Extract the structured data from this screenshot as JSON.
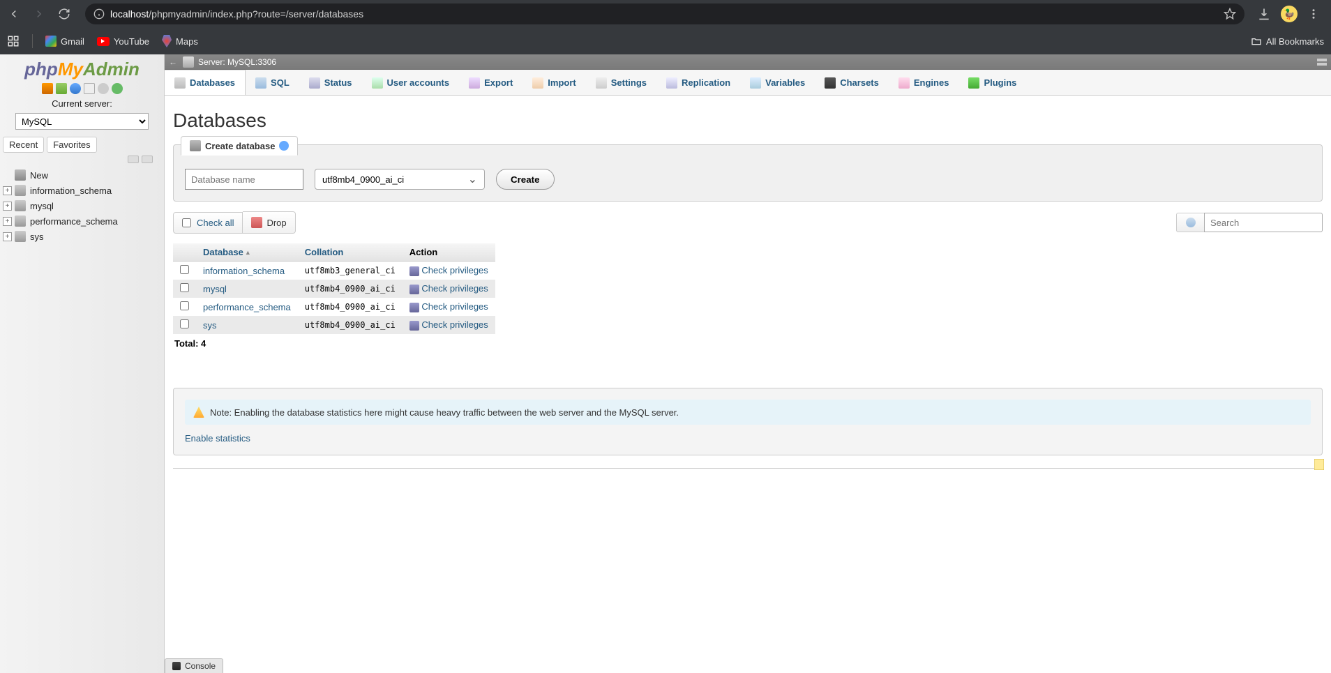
{
  "browser": {
    "url_host": "localhost",
    "url_path": "/phpmyadmin/index.php?route=/server/databases",
    "bookmarks": {
      "gmail": "Gmail",
      "youtube": "YouTube",
      "maps": "Maps",
      "all": "All Bookmarks"
    }
  },
  "sidebar": {
    "current_server_label": "Current server:",
    "server_value": "MySQL",
    "tabs": {
      "recent": "Recent",
      "favorites": "Favorites"
    },
    "new_label": "New",
    "nodes": [
      "information_schema",
      "mysql",
      "performance_schema",
      "sys"
    ]
  },
  "breadcrumb": {
    "server_label": "Server:",
    "server_value": "MySQL:3306"
  },
  "topmenu": {
    "databases": "Databases",
    "sql": "SQL",
    "status": "Status",
    "users": "User accounts",
    "export": "Export",
    "import": "Import",
    "settings": "Settings",
    "replication": "Replication",
    "variables": "Variables",
    "charsets": "Charsets",
    "engines": "Engines",
    "plugins": "Plugins"
  },
  "page": {
    "title": "Databases",
    "create_legend": "Create database",
    "dbname_placeholder": "Database name",
    "collation_value": "utf8mb4_0900_ai_ci",
    "create_btn": "Create",
    "check_all": "Check all",
    "drop": "Drop",
    "search_placeholder": "Search",
    "headers": {
      "database": "Database",
      "collation": "Collation",
      "action": "Action"
    },
    "rows": [
      {
        "name": "information_schema",
        "collation": "utf8mb3_general_ci",
        "action": "Check privileges"
      },
      {
        "name": "mysql",
        "collation": "utf8mb4_0900_ai_ci",
        "action": "Check privileges"
      },
      {
        "name": "performance_schema",
        "collation": "utf8mb4_0900_ai_ci",
        "action": "Check privileges"
      },
      {
        "name": "sys",
        "collation": "utf8mb4_0900_ai_ci",
        "action": "Check privileges"
      }
    ],
    "total_label": "Total: 4",
    "notice": "Note: Enabling the database statistics here might cause heavy traffic between the web server and the MySQL server.",
    "enable_stats": "Enable statistics"
  },
  "console_label": "Console"
}
